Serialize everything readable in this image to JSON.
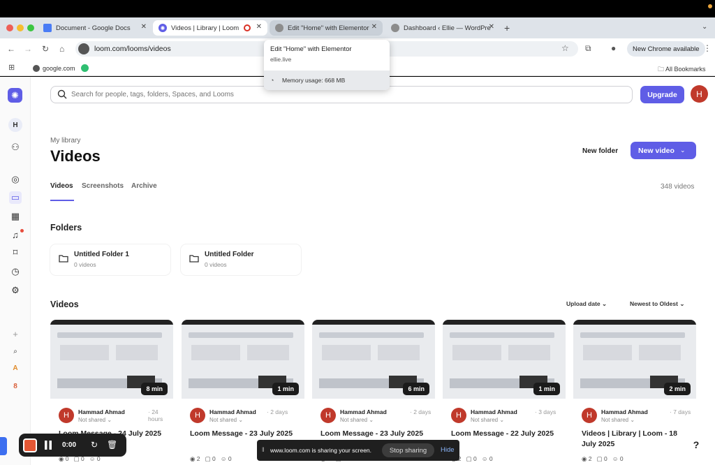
{
  "browser": {
    "tabs": [
      {
        "title": "Document - Google Docs",
        "icon": "docs-icon",
        "color": "#4a7cf5"
      },
      {
        "title": "Videos | Library | Loom",
        "icon": "loom-icon",
        "color": "#5f5de6"
      },
      {
        "title": "Edit \"Home\" with Elementor",
        "icon": "globe-icon",
        "color": "#888888"
      },
      {
        "title": "Dashboard ‹ Ellie — WordPre",
        "icon": "globe-icon",
        "color": "#888888"
      }
    ],
    "url": "loom.com/looms/videos",
    "new_chrome": "New Chrome available",
    "bookmark": "google.com",
    "all_bookmarks": "All Bookmarks"
  },
  "tooltip": {
    "title": "Edit \"Home\" with Elementor",
    "url": "ellie.live",
    "memory": "Memory usage: 668 MB"
  },
  "header": {
    "search_placeholder": "Search for people, tags, folders, Spaces, and Looms",
    "upgrade": "Upgrade",
    "avatar": "H"
  },
  "main": {
    "breadcrumb": "My library",
    "title": "Videos",
    "new_folder": "New folder",
    "new_video": "New video",
    "tabs": [
      "Videos",
      "Screenshots",
      "Archive"
    ],
    "count": "348 videos",
    "folders_heading": "Folders",
    "folders": [
      {
        "name": "Untitled Folder 1",
        "sub": "0 videos"
      },
      {
        "name": "Untitled Folder",
        "sub": "0 videos"
      }
    ],
    "videos_heading": "Videos",
    "sort_by": "Upload date",
    "sort_order": "Newest to Oldest",
    "videos": [
      {
        "duration": "8 min",
        "owner": "Hammad Ahmad",
        "time": "· 24 hours",
        "share": "Not shared ⌄",
        "title": "Loom Message - 24 July 2025",
        "views": "0",
        "comments": "0",
        "reactions": "0"
      },
      {
        "duration": "1 min",
        "owner": "Hammad Ahmad",
        "time": "· 2 days",
        "share": "Not shared ⌄",
        "title": "Loom Message - 23 July 2025",
        "views": "2",
        "comments": "0",
        "reactions": "0"
      },
      {
        "duration": "6 min",
        "owner": "Hammad Ahmad",
        "time": "· 2 days",
        "share": "Not shared ⌄",
        "title": "Loom Message - 23 July 2025",
        "views": "2",
        "comments": "0",
        "reactions": "0"
      },
      {
        "duration": "1 min",
        "owner": "Hammad Ahmad",
        "time": "· 3 days",
        "share": "Not shared ⌄",
        "title": "Loom Message - 22 July 2025",
        "views": "2",
        "comments": "0",
        "reactions": "0"
      },
      {
        "duration": "2 min",
        "owner": "Hammad Ahmad",
        "time": "· 7 days",
        "share": "Not shared ⌄",
        "title": "Videos | Library | Loom - 18 July 2025",
        "views": "2",
        "comments": "0",
        "reactions": "0"
      }
    ]
  },
  "recorder": {
    "time": "0:00"
  },
  "share_banner": {
    "text": "www.loom.com is sharing your screen.",
    "stop": "Stop sharing",
    "hide": "Hide"
  },
  "accent": "#5f5de6"
}
